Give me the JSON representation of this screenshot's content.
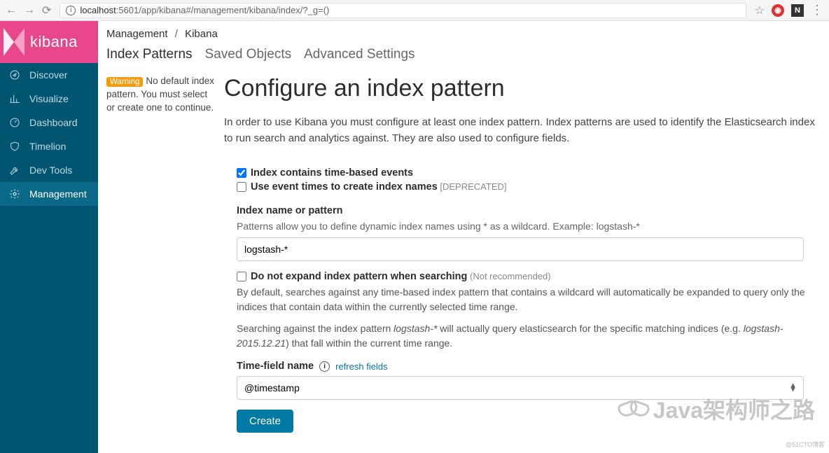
{
  "browser": {
    "url_host": "localhost",
    "url_path": ":5601/app/kibana#/management/kibana/index/?_g=()"
  },
  "logo": "kibana",
  "nav": [
    {
      "label": "Discover",
      "icon": "compass-icon"
    },
    {
      "label": "Visualize",
      "icon": "bar-chart-icon"
    },
    {
      "label": "Dashboard",
      "icon": "gauge-icon"
    },
    {
      "label": "Timelion",
      "icon": "shield-icon"
    },
    {
      "label": "Dev Tools",
      "icon": "wrench-icon"
    },
    {
      "label": "Management",
      "icon": "gear-icon"
    }
  ],
  "breadcrumb": {
    "a": "Management",
    "b": "Kibana"
  },
  "tabs": {
    "a": "Index Patterns",
    "b": "Saved Objects",
    "c": "Advanced Settings"
  },
  "warning": {
    "badge": "Warning",
    "text": "No default index pattern. You must select or create one to continue."
  },
  "page": {
    "title": "Configure an index pattern",
    "lead": "In order to use Kibana you must configure at least one index pattern. Index patterns are used to identify the Elasticsearch index to run search and analytics against. They are also used to configure fields."
  },
  "form": {
    "time_based_label": "Index contains time-based events",
    "event_times_label": "Use event times to create index names",
    "deprecated": " [DEPRECATED]",
    "index_label": "Index name or pattern",
    "index_help": "Patterns allow you to define dynamic index names using * as a wildcard. Example: logstash-*",
    "index_value": "logstash-*",
    "noexpand_label": "Do not expand index pattern when searching",
    "not_recommended": " (Not recommended)",
    "expand_help1": "By default, searches against any time-based index pattern that contains a wildcard will automatically be expanded to query only the indices that contain data within the currently selected time range.",
    "expand_help2a": "Searching against the index pattern ",
    "expand_help2b": "logstash-*",
    "expand_help2c": " will actually query elasticsearch for the specific matching indices (e.g. ",
    "expand_help2d": "logstash-2015.12.21",
    "expand_help2e": ") that fall within the current time range.",
    "time_field_label": "Time-field name",
    "refresh": "refresh fields",
    "time_field_value": "@timestamp",
    "create": "Create"
  },
  "watermark": "Java架构师之路",
  "small_watermark": "@51CTO博客"
}
